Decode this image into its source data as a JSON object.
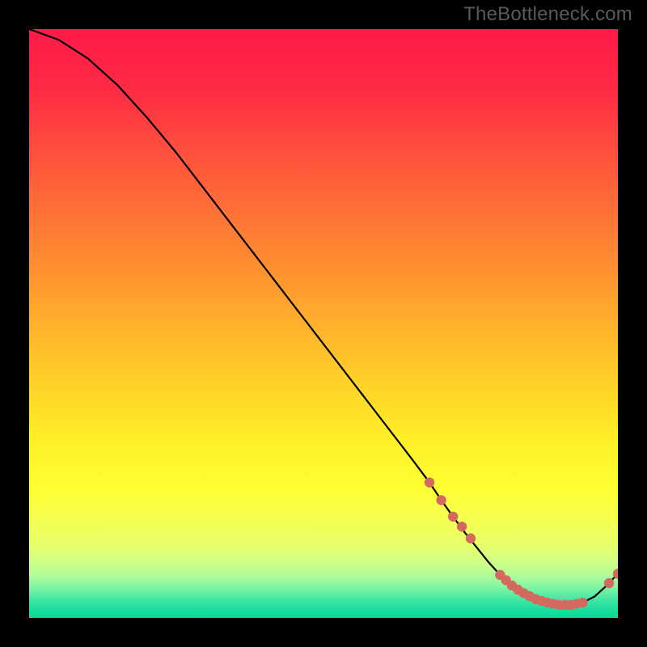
{
  "watermark": "TheBottleneck.com",
  "chart_data": {
    "type": "line",
    "title": "",
    "xlabel": "",
    "ylabel": "",
    "xlim": [
      0,
      100
    ],
    "ylim": [
      0,
      100
    ],
    "x": [
      0,
      5,
      10,
      15,
      20,
      25,
      30,
      35,
      40,
      45,
      50,
      55,
      60,
      65,
      68,
      70,
      72,
      74,
      76,
      78,
      80,
      82,
      84,
      86,
      88,
      90,
      92,
      94,
      96,
      98,
      100
    ],
    "y": [
      100.0,
      98.2,
      95.0,
      90.5,
      85.0,
      79.0,
      72.5,
      66.0,
      59.5,
      53.0,
      46.5,
      40.0,
      33.5,
      27.0,
      23.0,
      20.0,
      17.2,
      14.5,
      12.0,
      9.5,
      7.3,
      5.5,
      4.2,
      3.2,
      2.6,
      2.2,
      2.2,
      2.6,
      3.6,
      5.4,
      7.5
    ],
    "markers_x": [
      68,
      70,
      72,
      73.5,
      75,
      80,
      81,
      82,
      83,
      84,
      85,
      86,
      87,
      88,
      89,
      90,
      91,
      92,
      93,
      94,
      98.5,
      100
    ],
    "markers_y": [
      23.0,
      20.0,
      17.2,
      15.5,
      13.5,
      7.3,
      6.4,
      5.5,
      4.8,
      4.2,
      3.7,
      3.2,
      2.9,
      2.6,
      2.4,
      2.2,
      2.2,
      2.2,
      2.4,
      2.6,
      5.9,
      7.5
    ],
    "marker_color": "#d46a5f",
    "line_color": "#000000",
    "gradient_stops": [
      {
        "offset": 0.0,
        "color": "#ff1a48"
      },
      {
        "offset": 0.1,
        "color": "#ff2a44"
      },
      {
        "offset": 0.2,
        "color": "#ff4d3e"
      },
      {
        "offset": 0.3,
        "color": "#ff6e37"
      },
      {
        "offset": 0.4,
        "color": "#ff8e31"
      },
      {
        "offset": 0.5,
        "color": "#ffb02c"
      },
      {
        "offset": 0.6,
        "color": "#ffd228"
      },
      {
        "offset": 0.7,
        "color": "#fff028"
      },
      {
        "offset": 0.78,
        "color": "#ffff33"
      },
      {
        "offset": 0.84,
        "color": "#f4ff55"
      },
      {
        "offset": 0.88,
        "color": "#e4ff6e"
      },
      {
        "offset": 0.905,
        "color": "#d0ff86"
      },
      {
        "offset": 0.925,
        "color": "#b6fd97"
      },
      {
        "offset": 0.94,
        "color": "#95f8a0"
      },
      {
        "offset": 0.955,
        "color": "#6cf0a4"
      },
      {
        "offset": 0.97,
        "color": "#3fe6a3"
      },
      {
        "offset": 0.985,
        "color": "#1ddf9e"
      },
      {
        "offset": 1.0,
        "color": "#07da99"
      }
    ]
  }
}
